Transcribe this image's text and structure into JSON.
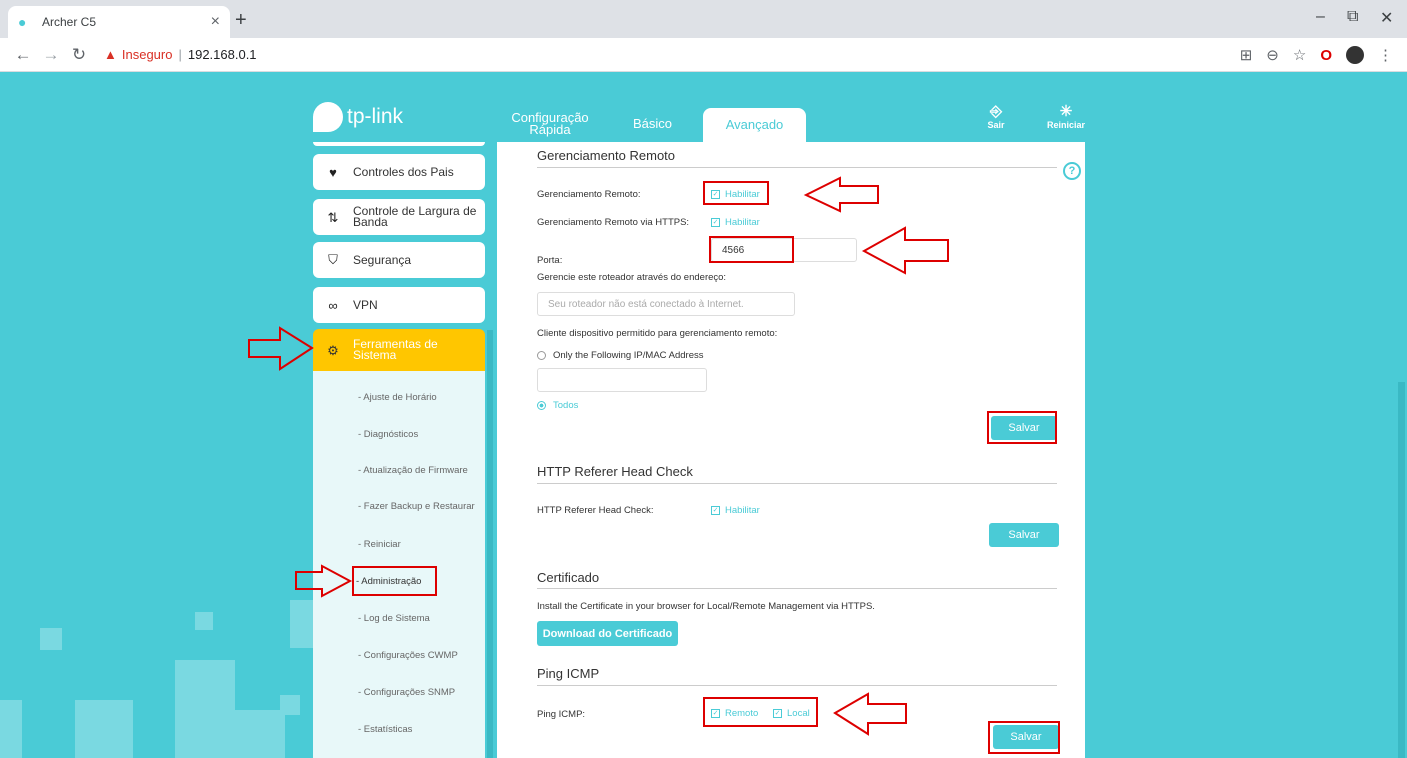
{
  "browser": {
    "tab_title": "Archer C5",
    "tab_close": "×",
    "new_tab": "+",
    "security_label": "Inseguro",
    "url": "192.168.0.1",
    "win_min": "–",
    "win_max": "⧉",
    "win_close": "✕"
  },
  "header": {
    "logo_text": "tp-link",
    "tabs": [
      "Configuração Rápida",
      "Básico",
      "Avançado"
    ],
    "exit_label": "Sair",
    "reboot_label": "Reiniciar"
  },
  "sidebar": {
    "items": [
      "Controles dos Pais",
      "Controle de Largura de Banda",
      "Segurança",
      "VPN",
      "Ferramentas de Sistema"
    ],
    "submenu": [
      "- Ajuste de Horário",
      "- Diagnósticos",
      "- Atualização de Firmware",
      "- Fazer Backup e Restaurar",
      "- Reiniciar",
      "- Administração",
      "- Log de Sistema",
      "- Configurações CWMP",
      "- Configurações SNMP",
      "- Estatísticas"
    ]
  },
  "remote": {
    "title": "Gerenciamento Remoto",
    "remote_label": "Gerenciamento Remoto:",
    "enable": "Habilitar",
    "https_label": "Gerenciamento Remoto via HTTPS:",
    "port_label": "Porta:",
    "port_value": "4566",
    "address_label": "Gerencie este roteador através do endereço:",
    "address_placeholder": "Seu roteador não está conectado à Internet.",
    "client_label": "Cliente dispositivo permitido para gerenciamento remoto:",
    "option_only": "Only the Following IP/MAC Address",
    "option_all": "Todos",
    "save": "Salvar"
  },
  "referer": {
    "title": "HTTP Referer Head Check",
    "label": "HTTP Referer Head Check:",
    "enable": "Habilitar",
    "save": "Salvar"
  },
  "certificate": {
    "title": "Certificado",
    "desc": "Install the Certificate in your browser for Local/Remote Management via HTTPS.",
    "download": "Download do Certificado"
  },
  "ping": {
    "title": "Ping ICMP",
    "label": "Ping ICMP:",
    "remote": "Remoto",
    "local": "Local",
    "save": "Salvar"
  },
  "colors": {
    "accent": "#4ACBD6",
    "active_menu": "#FFC600",
    "annotation": "#DD0000"
  }
}
